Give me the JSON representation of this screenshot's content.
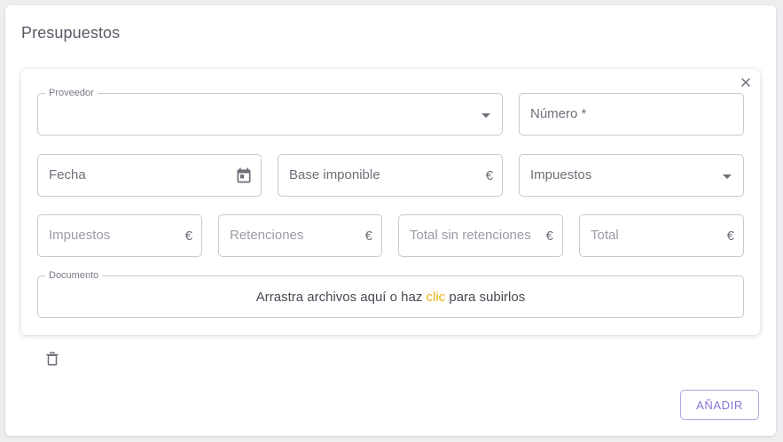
{
  "section": {
    "title": "Presupuestos"
  },
  "form": {
    "proveedor": {
      "legend": "Proveedor",
      "value": ""
    },
    "numero": {
      "placeholder": "Número *"
    },
    "fecha": {
      "placeholder": "Fecha"
    },
    "base_imponible": {
      "placeholder": "Base imponible",
      "suffix": "€"
    },
    "impuestos_select": {
      "placeholder": "Impuestos"
    },
    "impuestos_amount": {
      "placeholder": "Impuestos",
      "suffix": "€"
    },
    "retenciones": {
      "placeholder": "Retenciones",
      "suffix": "€"
    },
    "total_sin_retenciones": {
      "placeholder": "Total sin retenciones",
      "suffix": "€"
    },
    "total": {
      "placeholder": "Total",
      "suffix": "€"
    },
    "documento": {
      "legend": "Documento",
      "text_before": "Arrastra archivos aquí o haz ",
      "link": "clic",
      "text_after": " para subirlos"
    }
  },
  "actions": {
    "add_label": "AÑADIR"
  },
  "icons": {
    "close": "close-icon",
    "calendar": "calendar-icon",
    "dropdown": "chevron-down-icon",
    "delete": "trash-icon"
  },
  "colors": {
    "accent": "#8a73d6",
    "link": "#e8b20e",
    "border": "#c9c9d1",
    "background": "#eeeef1"
  }
}
